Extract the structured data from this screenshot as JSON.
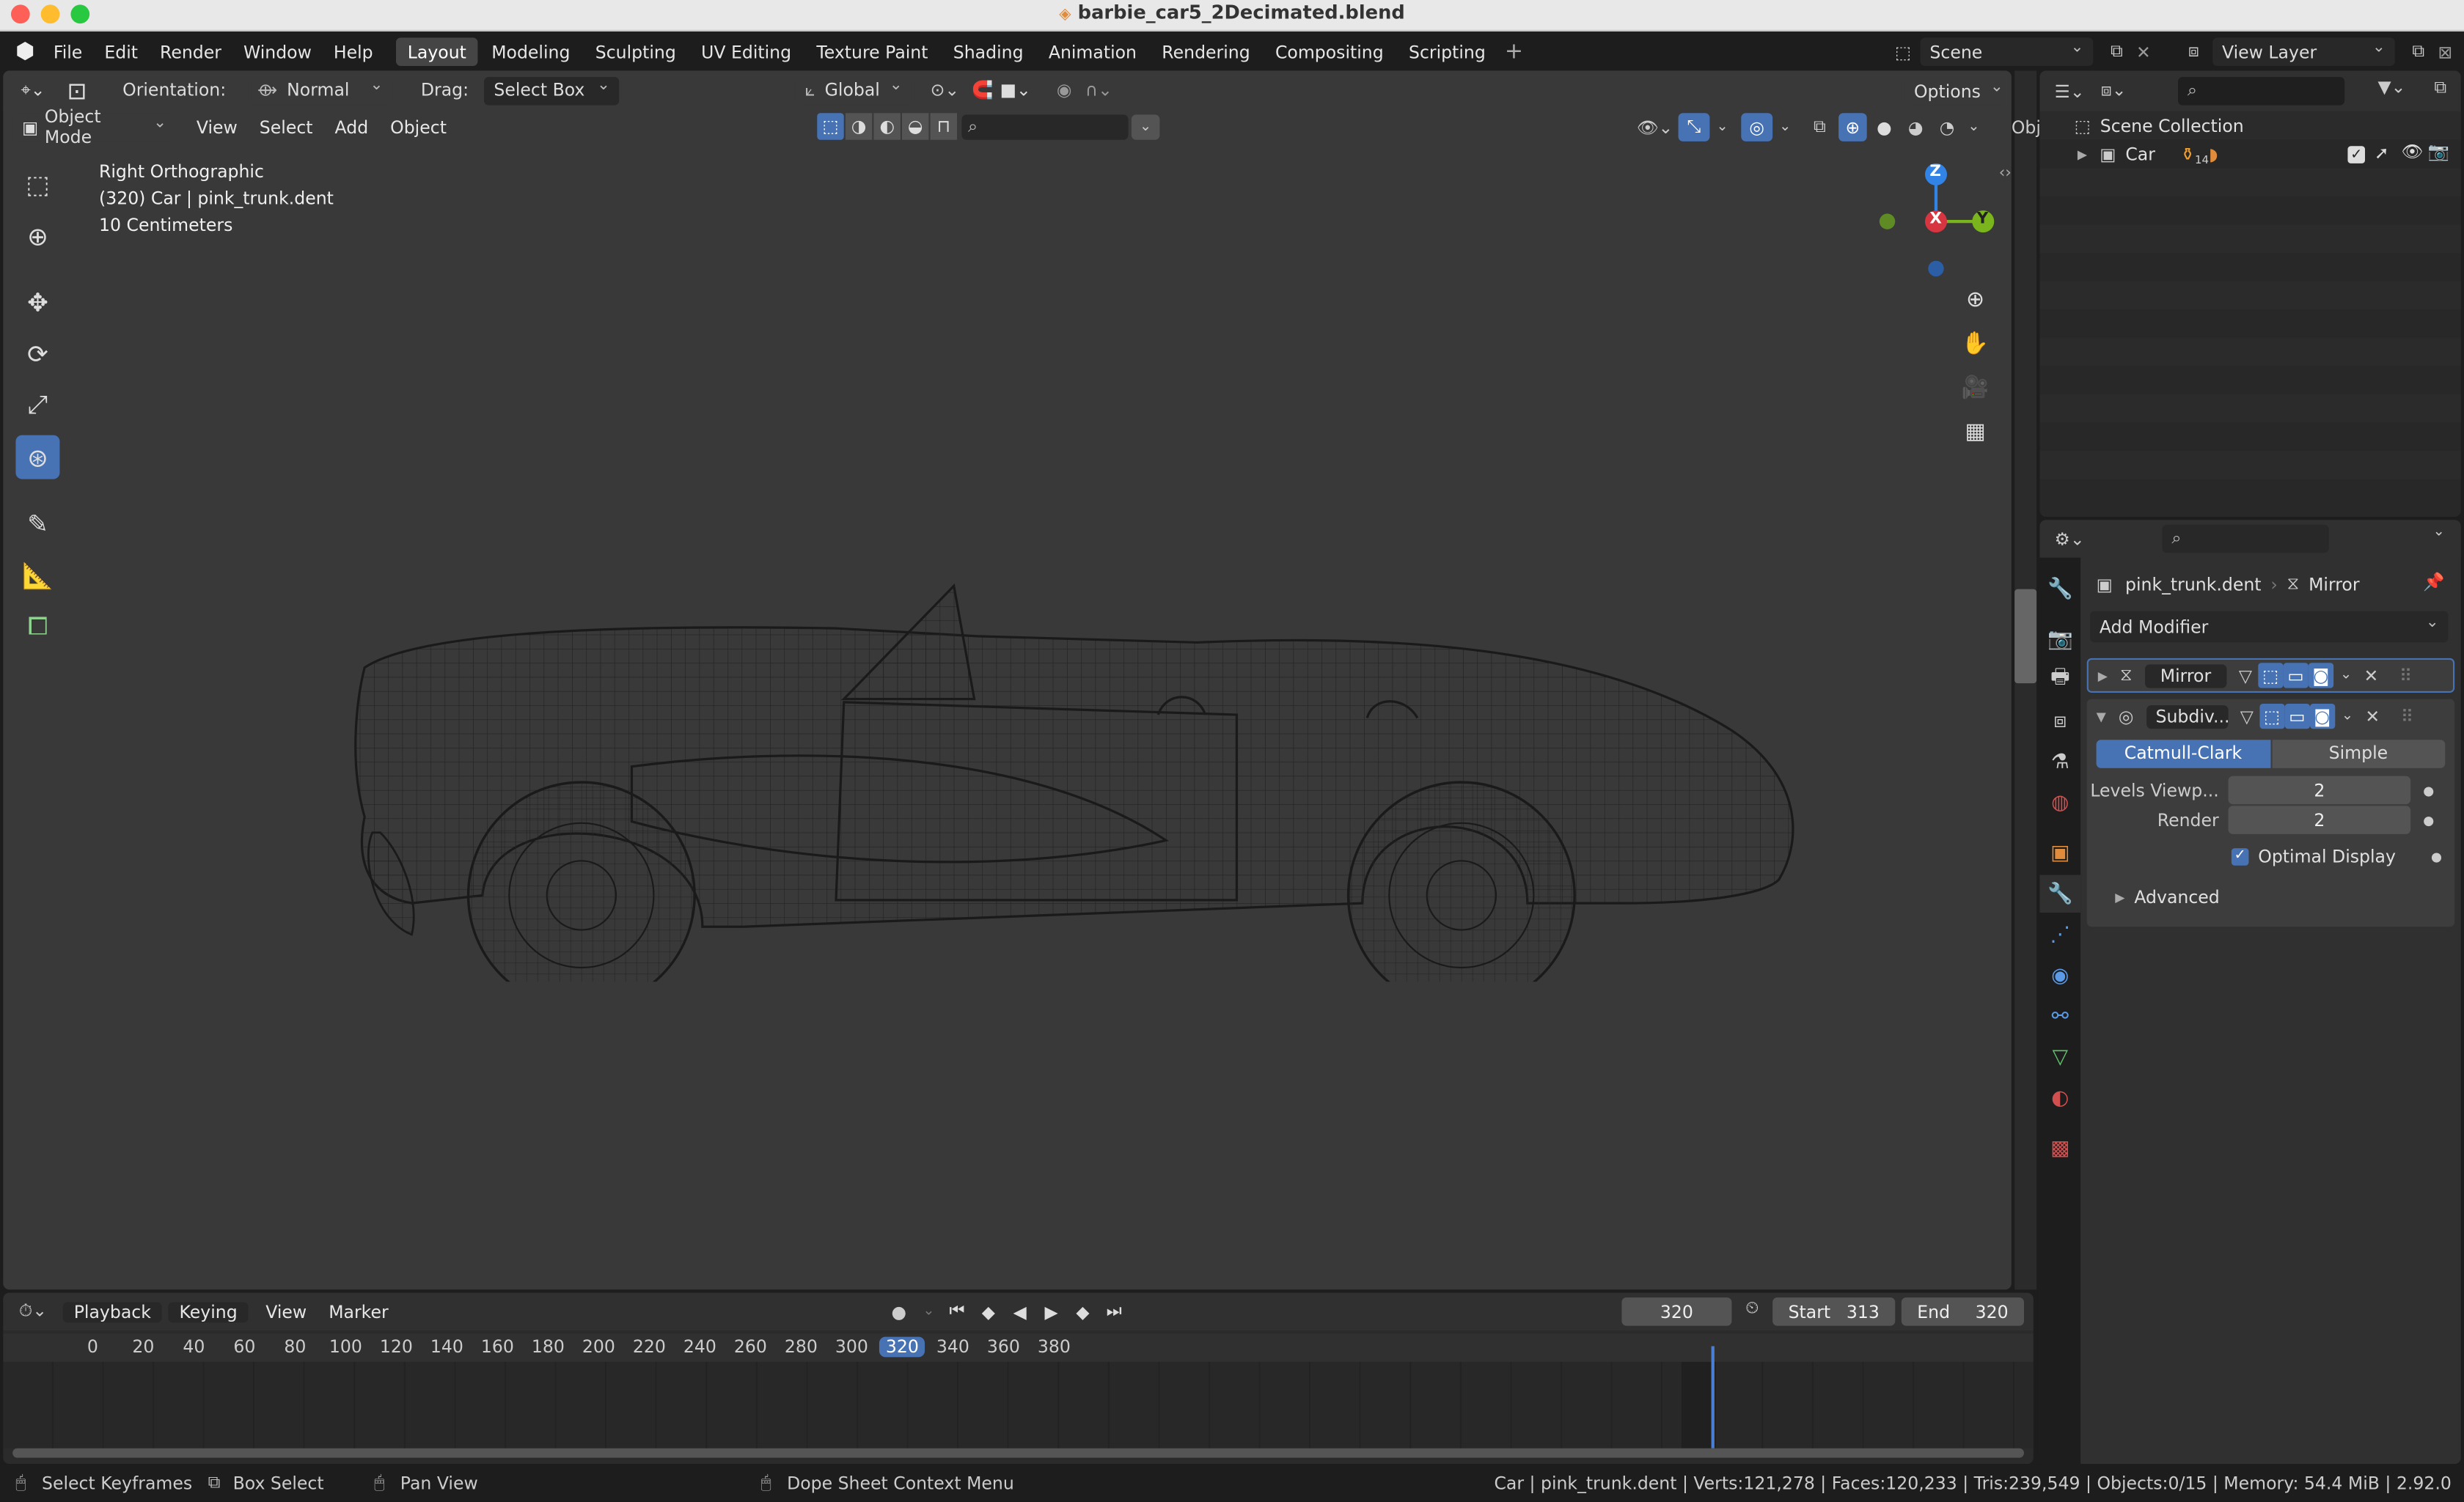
{
  "window": {
    "title": "barbie_car5_2Decimated.blend"
  },
  "topbar": {
    "menus": [
      "File",
      "Edit",
      "Render",
      "Window",
      "Help"
    ],
    "workspaces": [
      "Layout",
      "Modeling",
      "Sculpting",
      "UV Editing",
      "Texture Paint",
      "Shading",
      "Animation",
      "Rendering",
      "Compositing",
      "Scripting"
    ],
    "active_workspace": "Layout",
    "scene": "Scene",
    "view_layer": "View Layer"
  },
  "tool_header": {
    "orientation_label": "Orientation:",
    "orientation_value": "Normal",
    "drag_label": "Drag:",
    "drag_value": "Select Box",
    "transform_orientation": "Global",
    "options_label": "Options"
  },
  "viewport_header": {
    "mode": "Object Mode",
    "menus": [
      "View",
      "Select",
      "Add",
      "Object"
    ]
  },
  "viewport": {
    "view_name": "Right Orthographic",
    "object_info": "(320) Car | pink_trunk.dent",
    "scale_info": "10 Centimeters",
    "gizmo": {
      "z": "Z",
      "x": "X",
      "y": "Y"
    }
  },
  "outliner": {
    "root": "Scene Collection",
    "items": [
      {
        "name": "Car",
        "count": "14"
      }
    ],
    "clipped_label": "Obj"
  },
  "properties": {
    "object_name": "pink_trunk.dent",
    "modifier_context": "Mirror",
    "add_modifier": "Add Modifier",
    "modifiers": [
      {
        "name": "Mirror",
        "expanded": false
      },
      {
        "name": "Subdiv...",
        "expanded": true
      }
    ],
    "subdiv": {
      "types": [
        "Catmull-Clark",
        "Simple"
      ],
      "active_type": "Catmull-Clark",
      "levels_viewport_label": "Levels Viewp...",
      "levels_viewport": "2",
      "render_label": "Render",
      "render": "2",
      "optimal_display_label": "Optimal Display",
      "optimal_display": true,
      "advanced_label": "Advanced"
    }
  },
  "timeline": {
    "menus": [
      "Playback",
      "Keying",
      "View",
      "Marker"
    ],
    "current_frame": "320",
    "start_label": "Start",
    "start": "313",
    "end_label": "End",
    "end": "320",
    "ticks": [
      "0",
      "20",
      "40",
      "60",
      "80",
      "100",
      "120",
      "140",
      "160",
      "180",
      "200",
      "220",
      "240",
      "260",
      "280",
      "300",
      "320",
      "340",
      "360",
      "380"
    ]
  },
  "statusbar": {
    "hints": [
      "Select Keyframes",
      "Box Select",
      "Pan View",
      "Dope Sheet Context Menu"
    ],
    "stats": "Car | pink_trunk.dent | Verts:121,278 | Faces:120,233 | Tris:239,549 | Objects:0/15 | Memory: 54.4 MiB | 2.92.0"
  },
  "colors": {
    "accent": "#4772b3",
    "x_axis": "#d73540",
    "y_axis": "#7ab51d",
    "z_axis": "#3283e6",
    "bg_viewport": "#393939",
    "panel": "#303030"
  }
}
